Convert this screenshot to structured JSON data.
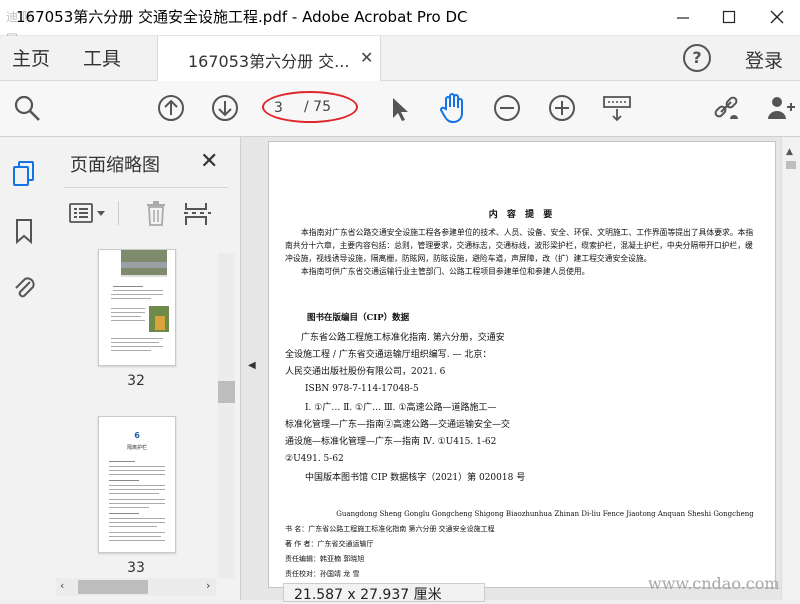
{
  "window": {
    "title": "167053第六分册  交通安全设施工程.pdf - Adobe Acrobat Pro DC",
    "logo_text": "迪  际  网"
  },
  "tabs": {
    "home": "主页",
    "tools": "工具",
    "document": "167053第六分册  交...",
    "login": "登录"
  },
  "toolbar": {
    "current_page": "3",
    "total_pages": "/ 75"
  },
  "thumb_panel": {
    "title": "页面缩略图",
    "thumbs": [
      {
        "label": "32"
      },
      {
        "label": "33",
        "chapter_number": "6",
        "chapter_title": "隔离护栏"
      }
    ]
  },
  "page": {
    "heading": "内  容  提  要",
    "intro_1": "本指南对广东省公路交通安全设施工程各参建单位的技术、人员、设备、安全、环保、文明施工、工作界面等提出了具体要求。本指南共分十六章，主要内容包括：总则，管理要求，交通标志，交通标线，波形梁护栏，缆索护栏，混凝土护栏，中央分隔带开口护栏，缓冲设施，视线诱导设施，隔离栅，防眩网，防眩设施，避险车道，声屏障，改（扩）建工程交通安全设施。",
    "intro_2": "本指南可供广东省交通运输行业主管部门、公路工程项目参建单位和参建人员使用。",
    "cip_title": "图书在版编目（CIP）数据",
    "cip_1": "广东省公路工程施工标准化指南. 第六分册，交通安",
    "cip_2": "全设施工程 / 广东省交通运输厅组织编写. — 北京：",
    "cip_3": "人民交通出版社股份有限公司，2021. 6",
    "cip_4": "ISBN 978-7-114-17048-5",
    "cip_5": "Ⅰ. ①广…   Ⅱ. ①广…   Ⅲ. ①高速公路—道路施工—",
    "cip_6": "标准化管理—广东—指南②高速公路—交通运输安全—交",
    "cip_7": "通设施—标准化管理—广东—指南   Ⅳ. ①U415. 1-62",
    "cip_8": "②U491. 5-62",
    "cip_9": "中国版本图书馆 CIP 数据核字（2021）第 020018 号",
    "pinyin": "Guangdong Sheng Gonglu Gongcheng Shigong Biaozhunhua Zhinan   Di-liu Fence   Jiaotong Anquan Sheshi Gongcheng",
    "meta_1": "书      名：广东省公路工程施工标准化指南    第六分册    交通安全设施工程",
    "meta_2": "著  作  者：广东省交通运输厅",
    "meta_3": "责任编辑：韩亚楠    郭晓旭",
    "meta_4": "责任校对：孙国靖    龙    雪"
  },
  "status": {
    "page_size": "21.587 x 27.937 厘米"
  },
  "watermark": "www.cndao.com",
  "colors": {
    "accent": "#1473e6",
    "highlight_ring": "#e0262a"
  }
}
